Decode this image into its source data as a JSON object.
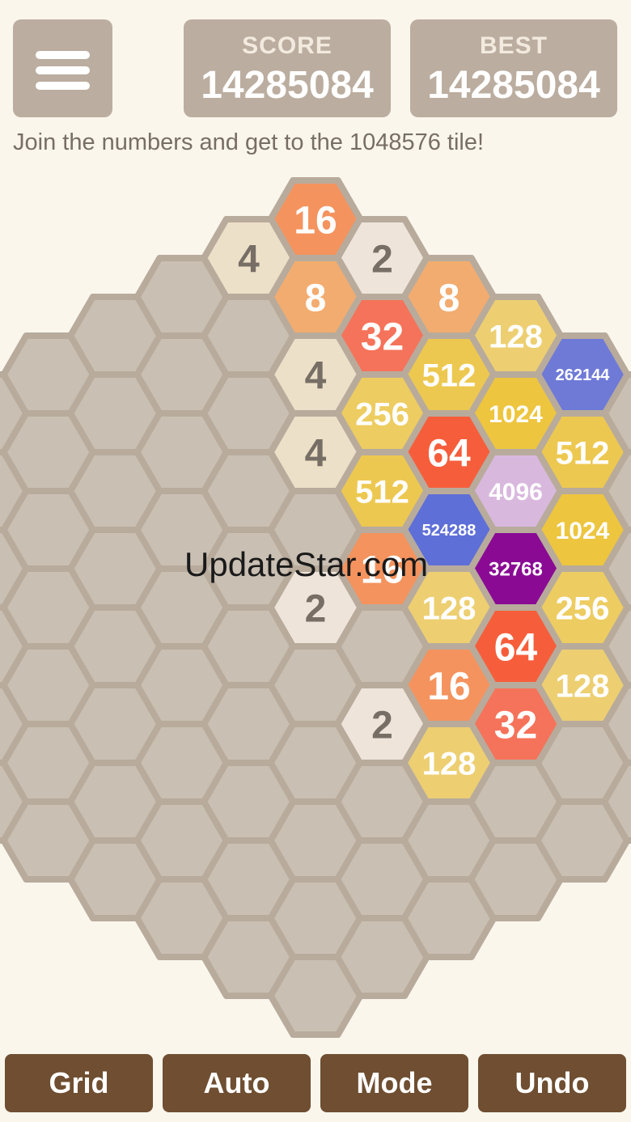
{
  "header": {
    "menu_icon": "hamburger-menu-icon",
    "score_label": "SCORE",
    "score_value": "14285084",
    "best_label": "BEST",
    "best_value": "14285084",
    "tagline": "Join the numbers and get to the 1048576 tile!"
  },
  "board": {
    "radius": 5,
    "colors": {
      "empty": "#c9bfb2",
      "border": "#b8ab9c",
      "background": "#faf6ec"
    },
    "tiles": [
      {
        "q": 0,
        "r": -5,
        "value": "16",
        "bg": "#f4935e",
        "fg": "#ffffff"
      },
      {
        "q": -1,
        "r": -4,
        "value": "4",
        "bg": "#ede0c8",
        "fg": "#776e65"
      },
      {
        "q": 1,
        "r": -5,
        "value": "2",
        "bg": "#eee4da",
        "fg": "#776e65"
      },
      {
        "q": 0,
        "r": -4,
        "value": "8",
        "bg": "#f3ac6f",
        "fg": "#ffffff"
      },
      {
        "q": 2,
        "r": -5,
        "value": "8",
        "bg": "#f3ac6f",
        "fg": "#ffffff"
      },
      {
        "q": 1,
        "r": -4,
        "value": "32",
        "bg": "#f5735a",
        "fg": "#ffffff"
      },
      {
        "q": 3,
        "r": -5,
        "value": "128",
        "bg": "#edcf72",
        "fg": "#ffffff"
      },
      {
        "q": 0,
        "r": -3,
        "value": "4",
        "bg": "#ede0c8",
        "fg": "#776e65"
      },
      {
        "q": 2,
        "r": -4,
        "value": "512",
        "bg": "#edc850",
        "fg": "#ffffff"
      },
      {
        "q": 4,
        "r": -5,
        "value": "262144",
        "bg": "#6f7ad7",
        "fg": "#ffffff"
      },
      {
        "q": 1,
        "r": -3,
        "value": "256",
        "bg": "#edcc61",
        "fg": "#ffffff"
      },
      {
        "q": 3,
        "r": -4,
        "value": "1024",
        "bg": "#edc53f",
        "fg": "#ffffff"
      },
      {
        "q": 0,
        "r": -2,
        "value": "4",
        "bg": "#ede0c8",
        "fg": "#776e65"
      },
      {
        "q": 2,
        "r": -3,
        "value": "64",
        "bg": "#f65e3b",
        "fg": "#ffffff"
      },
      {
        "q": 4,
        "r": -4,
        "value": "512",
        "bg": "#edc850",
        "fg": "#ffffff"
      },
      {
        "q": 1,
        "r": -2,
        "value": "512",
        "bg": "#edc850",
        "fg": "#ffffff"
      },
      {
        "q": 3,
        "r": -3,
        "value": "4096",
        "bg": "#d9b8de",
        "fg": "#ffffff"
      },
      {
        "q": 2,
        "r": -2,
        "value": "524288",
        "bg": "#5f6fd8",
        "fg": "#ffffff"
      },
      {
        "q": 4,
        "r": -3,
        "value": "1024",
        "bg": "#edc53f",
        "fg": "#ffffff"
      },
      {
        "q": 1,
        "r": -1,
        "value": "16",
        "bg": "#f4935e",
        "fg": "#ffffff"
      },
      {
        "q": 3,
        "r": -2,
        "value": "32768",
        "bg": "#8a0a94",
        "fg": "#ffffff"
      },
      {
        "q": 0,
        "r": 0,
        "value": "2",
        "bg": "#eee4da",
        "fg": "#776e65"
      },
      {
        "q": 2,
        "r": -1,
        "value": "128",
        "bg": "#edcf72",
        "fg": "#ffffff"
      },
      {
        "q": 4,
        "r": -2,
        "value": "256",
        "bg": "#edcc61",
        "fg": "#ffffff"
      },
      {
        "q": 3,
        "r": -1,
        "value": "64",
        "bg": "#f65e3b",
        "fg": "#ffffff"
      },
      {
        "q": 2,
        "r": 0,
        "value": "16",
        "bg": "#f4935e",
        "fg": "#ffffff"
      },
      {
        "q": 4,
        "r": -1,
        "value": "128",
        "bg": "#edcf72",
        "fg": "#ffffff"
      },
      {
        "q": 1,
        "r": 1,
        "value": "2",
        "bg": "#eee4da",
        "fg": "#776e65"
      },
      {
        "q": 3,
        "r": 0,
        "value": "32",
        "bg": "#f5735a",
        "fg": "#ffffff"
      },
      {
        "q": 2,
        "r": 1,
        "value": "128",
        "bg": "#edcf72",
        "fg": "#ffffff"
      }
    ]
  },
  "watermark": "UpdateStar.com",
  "buttons": {
    "grid": "Grid",
    "auto": "Auto",
    "mode": "Mode",
    "undo": "Undo",
    "color": "#6f4e31"
  }
}
